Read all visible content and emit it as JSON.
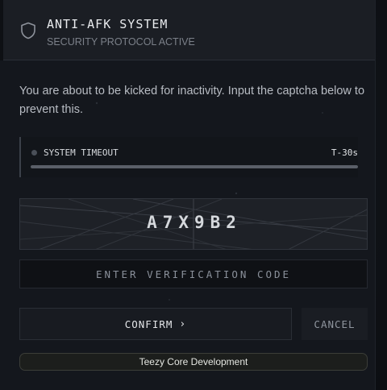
{
  "header": {
    "title": "ANTI-AFK SYSTEM",
    "subtitle": "SECURITY PROTOCOL ACTIVE",
    "icon": "shield-icon"
  },
  "message": "You are about to be kicked for inactivity. Input the captcha below to prevent this.",
  "timeout": {
    "label": "SYSTEM TIMEOUT",
    "value": "T-30s",
    "progress": 1.0
  },
  "captcha": {
    "code": "A7X9B2"
  },
  "input": {
    "placeholder": "ENTER VERIFICATION CODE",
    "value": ""
  },
  "buttons": {
    "confirm_label": "CONFIRM",
    "confirm_icon": "chevron-right-icon",
    "cancel_label": "CANCEL"
  },
  "footer": {
    "label": "Teezy Core Development"
  }
}
